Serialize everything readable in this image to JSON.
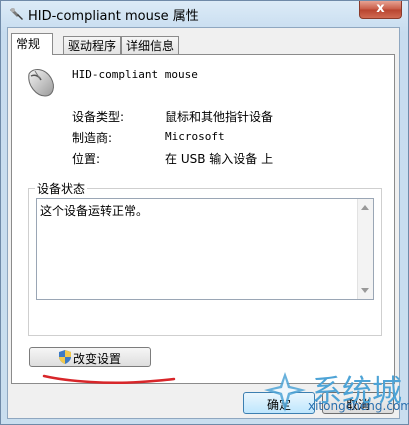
{
  "window": {
    "title": "HID-compliant mouse 属性",
    "close_glyph": "x"
  },
  "tabs": [
    {
      "label": "常规",
      "active": true
    },
    {
      "label": "驱动程序",
      "active": false
    },
    {
      "label": "详细信息",
      "active": false
    }
  ],
  "device": {
    "name": "HID-compliant mouse",
    "icon": "mouse-icon"
  },
  "properties": [
    {
      "label": "设备类型:",
      "value": "鼠标和其他指针设备"
    },
    {
      "label": "制造商:",
      "value": "Microsoft"
    },
    {
      "label": "位置:",
      "value": "在 USB 输入设备 上"
    }
  ],
  "status": {
    "group_title": "设备状态",
    "text": "这个设备运转正常。"
  },
  "buttons": {
    "change_settings": "改变设置",
    "ok": "确定",
    "cancel": "取消"
  },
  "watermark": {
    "brand": "系统城",
    "url": "xitongcheng.com"
  },
  "colors": {
    "title_bar": "#c9deef",
    "close_button": "#c75a45",
    "annotation_underline": "#d8262a",
    "watermark_blue": "#4da3d6"
  }
}
